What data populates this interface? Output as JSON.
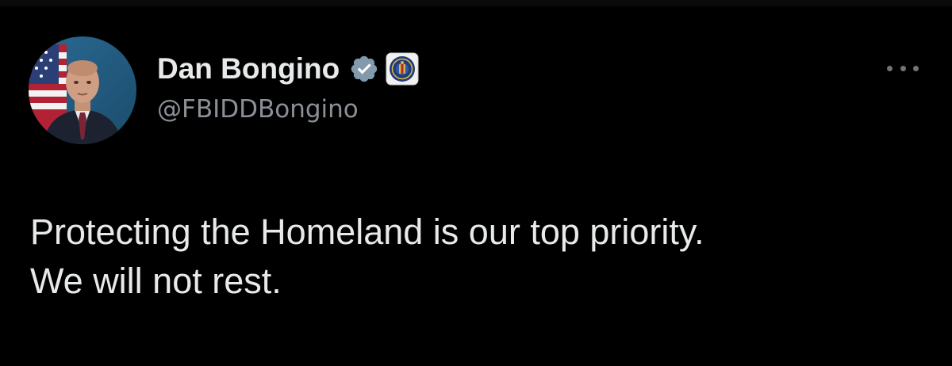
{
  "author": {
    "display_name": "Dan Bongino",
    "handle": "@FBIDDBongino",
    "verified": true,
    "affiliate_badge": "fbi-seal-icon"
  },
  "tweet": {
    "lines": [
      "Protecting the Homeland is our top priority.",
      "We will not rest."
    ]
  },
  "icons": {
    "verified": "verified-check-icon",
    "more": "more-options-icon"
  },
  "colors": {
    "background": "#000000",
    "text_primary": "#e7e9ea",
    "text_secondary": "#8b9097",
    "verified_badge": "#829aab"
  }
}
